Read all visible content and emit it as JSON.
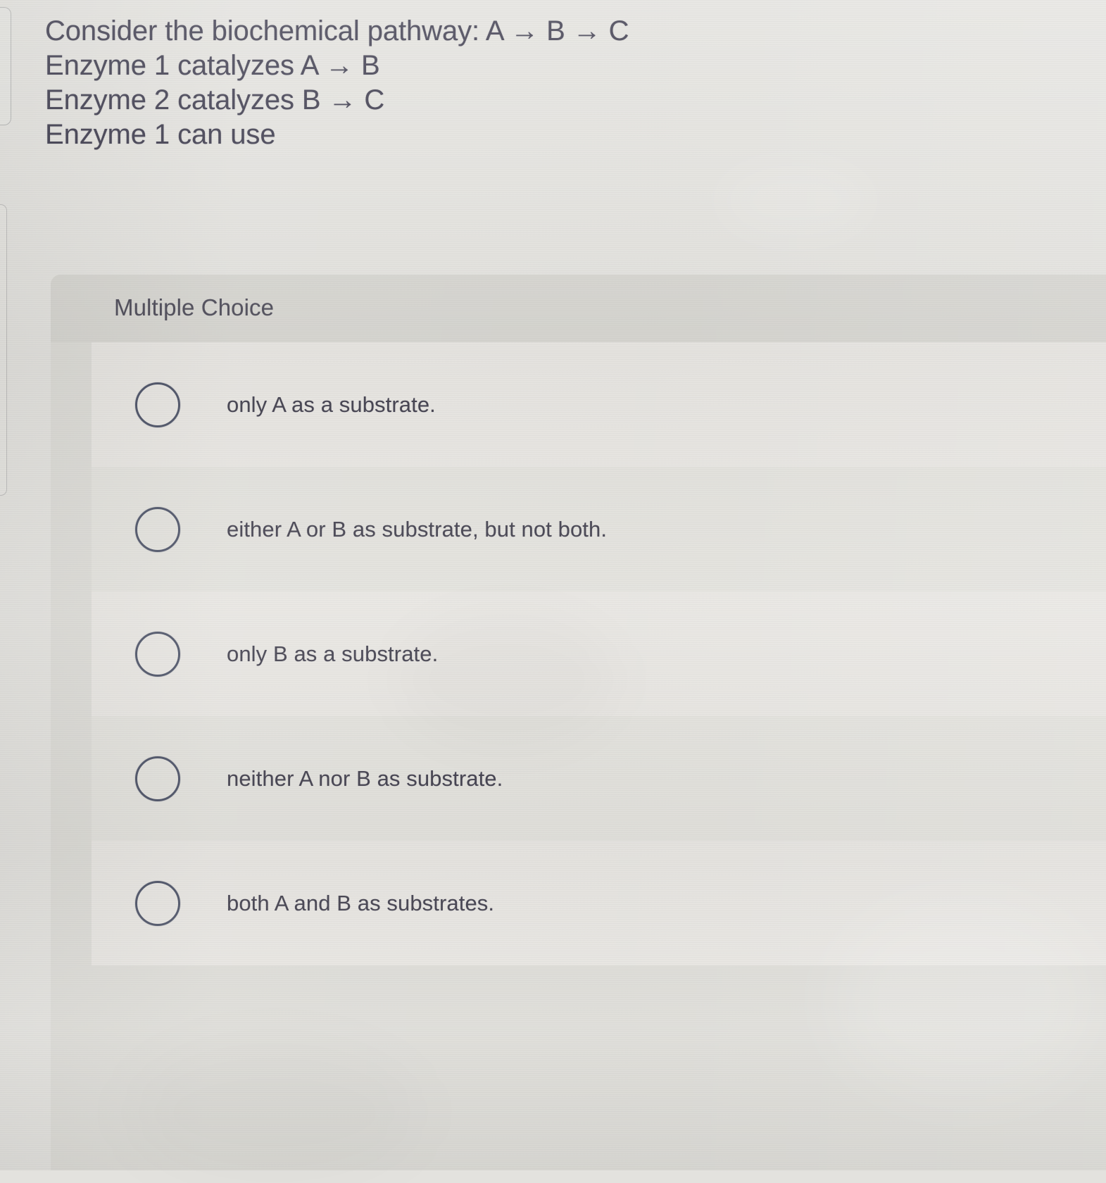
{
  "question": {
    "lines": [
      "Consider the biochemical pathway: A → B → C",
      "Enzyme 1 catalyzes A → B",
      "Enzyme 2 catalyzes B → C",
      "Enzyme 1 can use"
    ]
  },
  "answer_panel": {
    "header_label": "Multiple Choice",
    "options": [
      {
        "id": "a",
        "label": "only A as a substrate.",
        "selected": false
      },
      {
        "id": "b",
        "label": "either A or B as substrate, but not both.",
        "selected": false
      },
      {
        "id": "c",
        "label": "only B as a substrate.",
        "selected": false
      },
      {
        "id": "d",
        "label": "neither A nor B as substrate.",
        "selected": false
      },
      {
        "id": "e",
        "label": "both A and B as substrates.",
        "selected": false
      }
    ]
  },
  "colors": {
    "page_background": "#e3e2de",
    "panel_background": "#dcdbd6",
    "panel_header_background": "#d6d5d0",
    "row_band_light": "#e7e5e1",
    "row_band_dark": "#e2e1dc",
    "text": "#3f3d4b",
    "radio_outline": "#4c5266"
  }
}
